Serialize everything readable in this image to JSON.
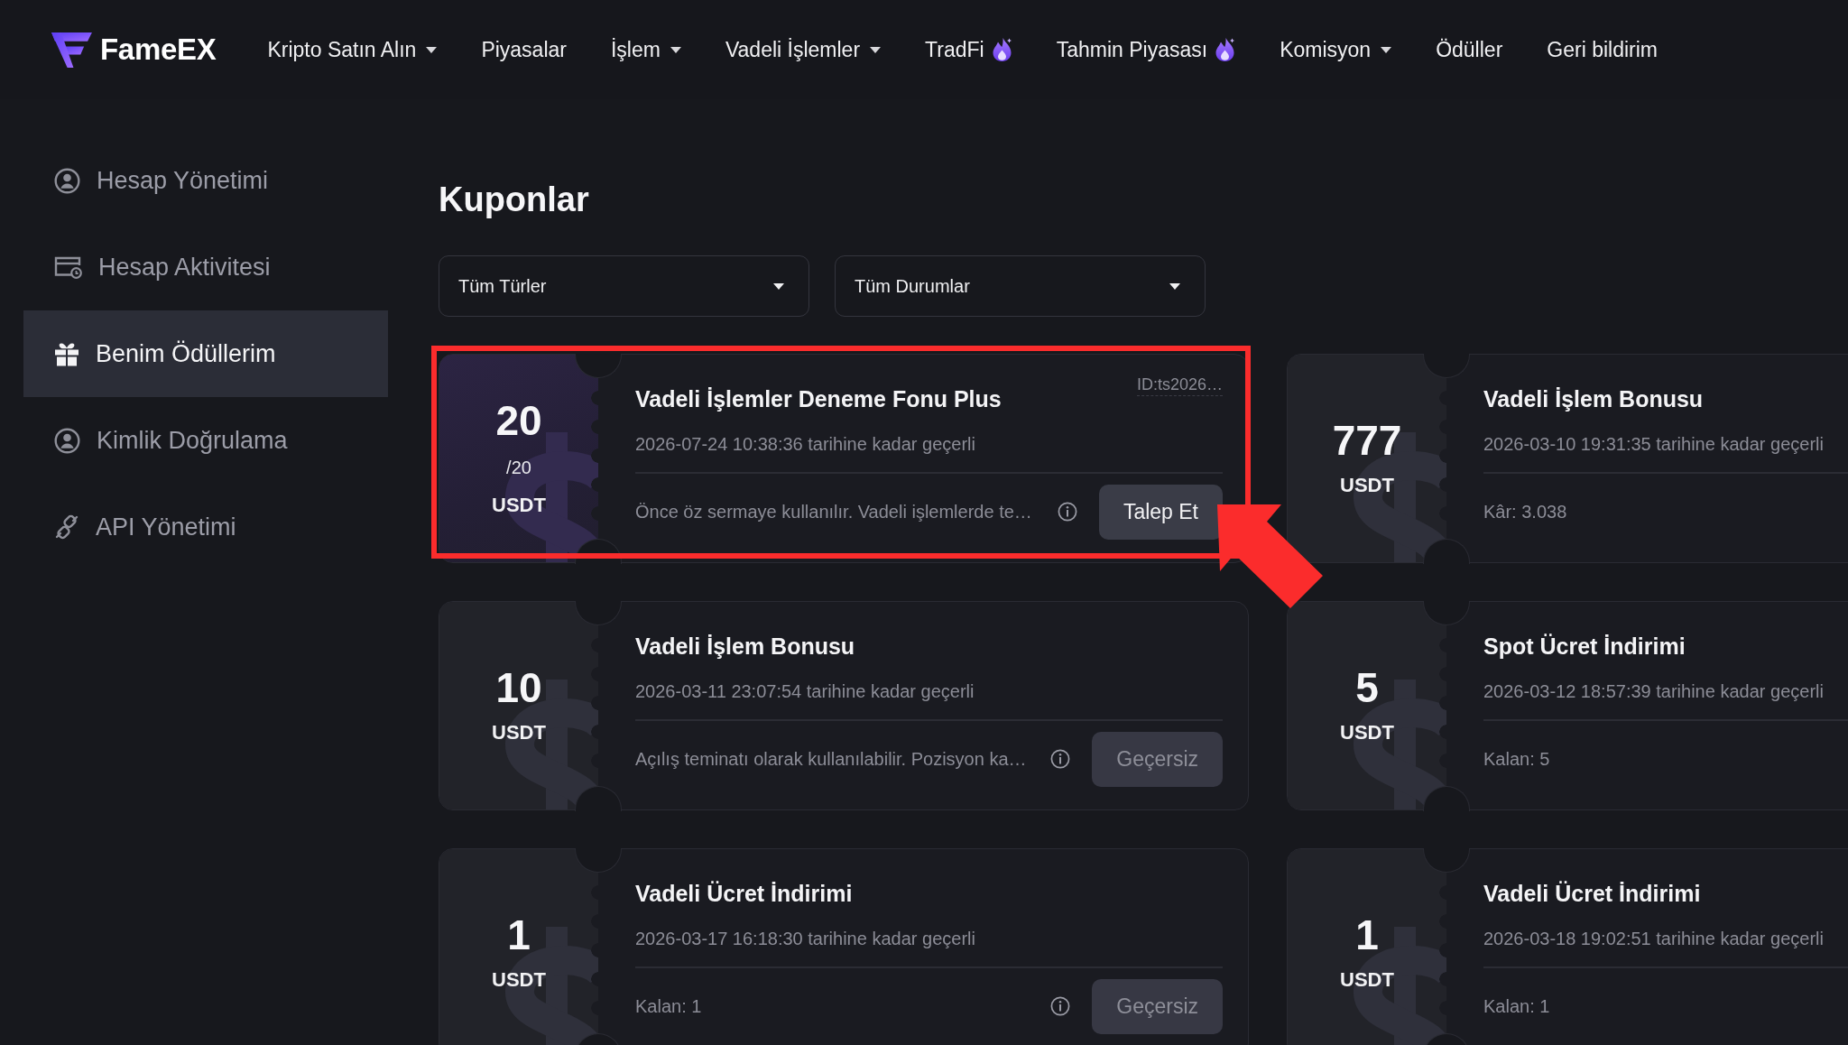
{
  "nav": {
    "logo": "FameEX",
    "items": [
      {
        "label": "Kripto Satın Alın",
        "dropdown": true,
        "hot": false
      },
      {
        "label": "Piyasalar",
        "dropdown": false,
        "hot": false
      },
      {
        "label": "İşlem",
        "dropdown": true,
        "hot": false
      },
      {
        "label": "Vadeli İşlemler",
        "dropdown": true,
        "hot": false
      },
      {
        "label": "TradFi",
        "dropdown": false,
        "hot": true
      },
      {
        "label": "Tahmin Piyasası",
        "dropdown": false,
        "hot": true
      },
      {
        "label": "Komisyon",
        "dropdown": true,
        "hot": false
      },
      {
        "label": "Ödüller",
        "dropdown": false,
        "hot": false
      },
      {
        "label": "Geri bildirim",
        "dropdown": false,
        "hot": false
      }
    ]
  },
  "sidebar": {
    "items": [
      {
        "label": "Hesap Yönetimi",
        "selected": false
      },
      {
        "label": "Hesap Aktivitesi",
        "selected": false
      },
      {
        "label": "Benim Ödüllerim",
        "selected": true
      },
      {
        "label": "Kimlik Doğrulama",
        "selected": false
      },
      {
        "label": "API Yönetimi",
        "selected": false
      }
    ]
  },
  "coupons": {
    "title": "Kuponlar",
    "filters": [
      {
        "value": "Tüm Türler"
      },
      {
        "value": "Tüm Durumlar"
      }
    ],
    "cards": [
      {
        "amount": "20",
        "total": "/20",
        "unit": "USDT",
        "active": true,
        "highlighted": true,
        "title": "Vadeli İşlemler Deneme Fonu Plus",
        "id": "ID:ts2026…",
        "date": "2026-07-24 10:38:36 tarihine kadar geçerli",
        "note": "Önce öz sermaye kullanılır. Vadeli işlemlerde te…",
        "info_icon": true,
        "button": {
          "label": "Talep Et",
          "disabled": false
        }
      },
      {
        "amount": "777",
        "unit": "USDT",
        "active": false,
        "highlighted": false,
        "title": "Vadeli İşlem Bonusu",
        "date": "2026-03-10 19:31:35 tarihine kadar geçerli",
        "note": "Kâr: 3.038",
        "info_icon": false
      },
      {
        "amount": "10",
        "unit": "USDT",
        "active": false,
        "highlighted": false,
        "title": "Vadeli İşlem Bonusu",
        "date": "2026-03-11 23:07:54 tarihine kadar geçerli",
        "note": "Açılış teminatı olarak kullanılabilir. Pozisyon ka…",
        "info_icon": true,
        "button": {
          "label": "Geçersiz",
          "disabled": true
        }
      },
      {
        "amount": "5",
        "unit": "USDT",
        "active": false,
        "highlighted": false,
        "title": "Spot Ücret İndirimi",
        "date": "2026-03-12 18:57:39 tarihine kadar geçerli",
        "note": "Kalan: 5",
        "info_icon": false
      },
      {
        "amount": "1",
        "unit": "USDT",
        "active": false,
        "highlighted": false,
        "title": "Vadeli Ücret İndirimi",
        "date": "2026-03-17 16:18:30 tarihine kadar geçerli",
        "note": "Kalan: 1",
        "info_icon": true,
        "button": {
          "label": "Geçersiz",
          "disabled": true
        }
      },
      {
        "amount": "1",
        "unit": "USDT",
        "active": false,
        "highlighted": false,
        "title": "Vadeli Ücret İndirimi",
        "date": "2026-03-18 19:02:51 tarihine kadar geçerli",
        "note": "Kalan: 1",
        "info_icon": false
      }
    ]
  }
}
